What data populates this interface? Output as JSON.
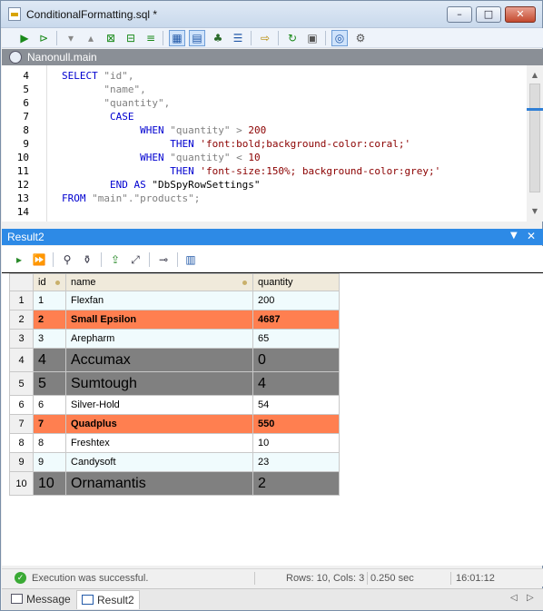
{
  "window": {
    "title": "ConditionalFormatting.sql *",
    "controls": {
      "minimize": "–",
      "maximize": "□",
      "close": "✕"
    }
  },
  "toolbar": {
    "icons": [
      "execute-icon",
      "execute-debug-icon",
      "collapse-icon",
      "expand-icon",
      "collapse-all-icon",
      "expand-all-icon",
      "fold-icon",
      "grid-view-icon",
      "text-view-icon",
      "tree-view-icon",
      "layout-icon",
      "export-icon",
      "refresh-icon",
      "properties-icon",
      "gauge-icon",
      "schema-icon"
    ]
  },
  "editor": {
    "connection": "Nanonull.main",
    "lines": [
      {
        "n": "4",
        "segments": [
          [
            "kw",
            "SELECT "
          ],
          [
            "id",
            "\"id\""
          ],
          [
            "op",
            ","
          ]
        ]
      },
      {
        "n": "5",
        "segments": [
          [
            "sp",
            "       "
          ],
          [
            "id",
            "\"name\""
          ],
          [
            "op",
            ","
          ]
        ]
      },
      {
        "n": "6",
        "segments": [
          [
            "sp",
            "       "
          ],
          [
            "id",
            "\"quantity\""
          ],
          [
            "op",
            ","
          ]
        ]
      },
      {
        "n": "7",
        "segments": [
          [
            "sp",
            "        "
          ],
          [
            "kw",
            "CASE"
          ]
        ]
      },
      {
        "n": "8",
        "segments": [
          [
            "sp",
            "             "
          ],
          [
            "kw",
            "WHEN "
          ],
          [
            "id",
            "\"quantity\""
          ],
          [
            "op",
            " > "
          ],
          [
            "num",
            "200"
          ]
        ]
      },
      {
        "n": "9",
        "segments": [
          [
            "sp",
            "                  "
          ],
          [
            "kw",
            "THEN "
          ],
          [
            "str",
            "'font:bold;background-color:coral;'"
          ]
        ]
      },
      {
        "n": "10",
        "segments": [
          [
            "sp",
            "             "
          ],
          [
            "kw",
            "WHEN "
          ],
          [
            "id",
            "\"quantity\""
          ],
          [
            "op",
            " < "
          ],
          [
            "num",
            "10"
          ]
        ]
      },
      {
        "n": "11",
        "segments": [
          [
            "sp",
            "                  "
          ],
          [
            "kw",
            "THEN "
          ],
          [
            "str",
            "'font-size:150%; background-color:grey;'"
          ]
        ]
      },
      {
        "n": "12",
        "segments": [
          [
            "sp",
            "        "
          ],
          [
            "kw",
            "END AS "
          ],
          [
            "plain",
            "\"DbSpyRowSettings\""
          ]
        ]
      },
      {
        "n": "13",
        "segments": [
          [
            "kw",
            "FROM "
          ],
          [
            "id",
            "\"main\""
          ],
          [
            "op",
            "."
          ],
          [
            "id",
            "\"products\""
          ],
          [
            "op",
            ";"
          ]
        ]
      },
      {
        "n": "14",
        "segments": []
      }
    ]
  },
  "result": {
    "title": "Result2",
    "columns": [
      "id",
      "name",
      "quantity"
    ],
    "rows": [
      {
        "rn": "1",
        "id": "1",
        "name": "Flexfan",
        "quantity": "200",
        "style": "norm"
      },
      {
        "rn": "2",
        "id": "2",
        "name": "Small Epsilon",
        "quantity": "4687",
        "style": "coral"
      },
      {
        "rn": "3",
        "id": "3",
        "name": "Arepharm",
        "quantity": "65",
        "style": "norm"
      },
      {
        "rn": "4",
        "id": "4",
        "name": "Accumax",
        "quantity": "0",
        "style": "grey"
      },
      {
        "rn": "5",
        "id": "5",
        "name": "Sumtough",
        "quantity": "4",
        "style": "grey"
      },
      {
        "rn": "6",
        "id": "6",
        "name": "Silver-Hold",
        "quantity": "54",
        "style": "white"
      },
      {
        "rn": "7",
        "id": "7",
        "name": "Quadplus",
        "quantity": "550",
        "style": "coral"
      },
      {
        "rn": "8",
        "id": "8",
        "name": "Freshtex",
        "quantity": "10",
        "style": "white"
      },
      {
        "rn": "9",
        "id": "9",
        "name": "Candysoft",
        "quantity": "23",
        "style": "norm"
      },
      {
        "rn": "10",
        "id": "10",
        "name": "Ornamantis",
        "quantity": "2",
        "style": "grey"
      }
    ],
    "colors": {
      "coral": "#ff7f50",
      "grey": "#808080"
    }
  },
  "status": {
    "message": "Execution was successful.",
    "rows_cols": "Rows: 10, Cols: 3",
    "time": "0.250 sec",
    "clock": "16:01:12"
  },
  "tabs": [
    {
      "label": "Message"
    },
    {
      "label": "Result2"
    }
  ]
}
